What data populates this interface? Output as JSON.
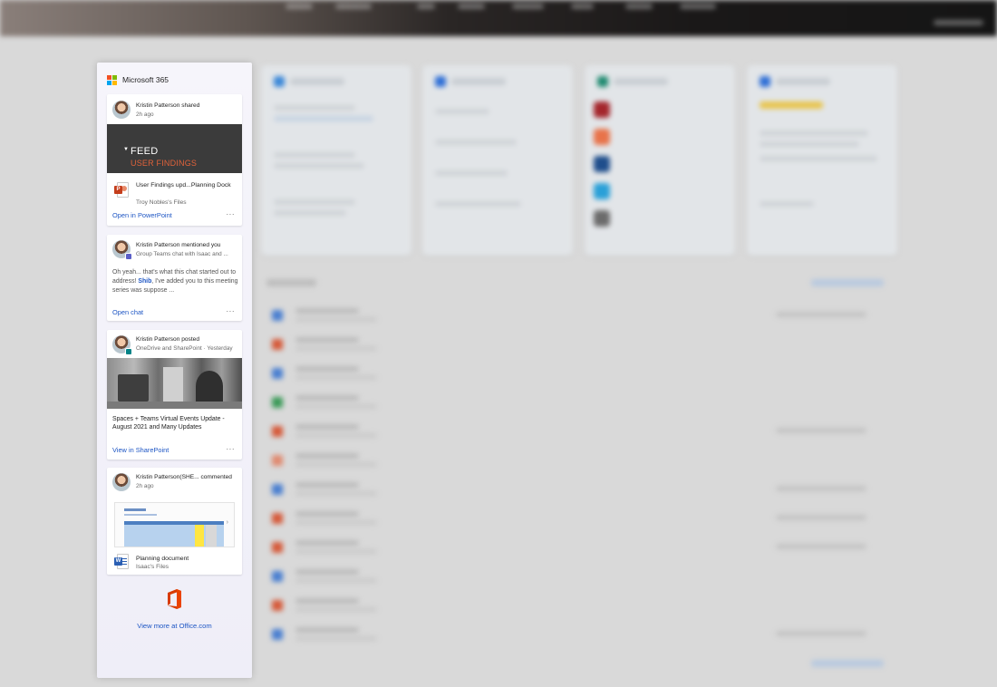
{
  "panel": {
    "title": "Microsoft 365",
    "view_more_label": "View more at Office.com"
  },
  "cards": [
    {
      "kind": "shared-file",
      "actor": "Kristin Patterson shared",
      "time": "2h ago",
      "preview_title": "FEED",
      "preview_subtitle": "USER FINDINGS",
      "file_name": "User Findings upd...Planning Dock",
      "file_location": "Troy Nobles's Files",
      "action_label": "Open in PowerPoint",
      "more_label": "···"
    },
    {
      "kind": "mention",
      "actor": "Kristin Patterson mentioned you",
      "context": "Group Teams chat with Isaac and ...",
      "message_before": "Oh yeah... that's what this chat started out to address! ",
      "mention": "Shib",
      "message_after": ", I've added you to this meeting series was suppose ...",
      "action_label": "Open chat",
      "more_label": "···"
    },
    {
      "kind": "post",
      "actor": "Kristin Patterson posted",
      "context": "OneDrive and SharePoint · Yesterday",
      "title": "Spaces + Teams Virtual Events Update - August 2021 and Many Updates",
      "action_label": "View in SharePoint",
      "more_label": "···"
    },
    {
      "kind": "comment",
      "actor": "Kristin Patterson(SHE... commented",
      "time": "2h ago",
      "file_name": "Planning document",
      "file_location": "Isaac's Files"
    }
  ],
  "colors": {
    "link": "#1e56c4",
    "powerpoint": "#c43e1c",
    "word": "#2b5fb3",
    "office": "#d83b01"
  },
  "icons": {
    "microsoft-logo": "four-color-grid",
    "powerpoint": "ppt-file-icon",
    "word": "word-file-icon",
    "office": "office-logo"
  }
}
